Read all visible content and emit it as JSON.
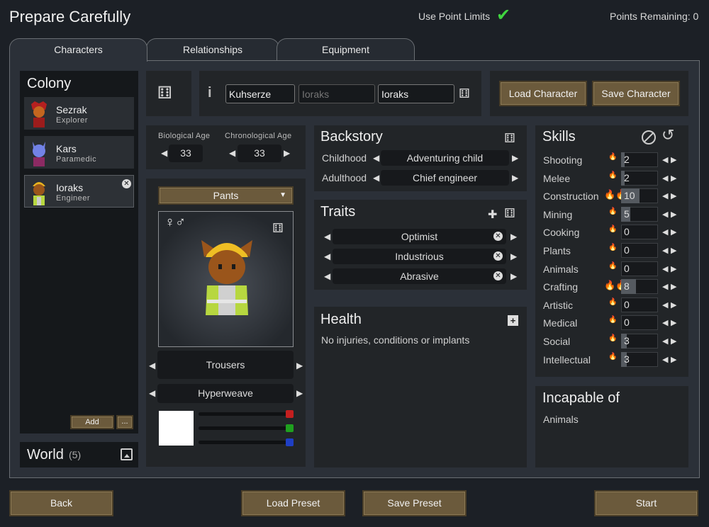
{
  "app_title": "Prepare Carefully",
  "point_limits": {
    "label": "Use Point Limits",
    "enabled": true
  },
  "points_remaining": "Points Remaining: 0",
  "tabs": [
    {
      "label": "Characters",
      "active": true
    },
    {
      "label": "Relationships",
      "active": false
    },
    {
      "label": "Equipment",
      "active": false
    }
  ],
  "colony": {
    "title": "Colony",
    "pawns": [
      {
        "name": "Sezrak",
        "role": "Explorer"
      },
      {
        "name": "Kars",
        "role": "Paramedic"
      },
      {
        "name": "Ioraks",
        "role": "Engineer",
        "selected": true
      }
    ],
    "add_label": "Add",
    "more_label": "..."
  },
  "world": {
    "title": "World",
    "count": "(5)"
  },
  "name_fields": {
    "first": "Kuhserze",
    "nick_placeholder": "Ioraks",
    "last": "Ioraks"
  },
  "load_character": "Load Character",
  "save_character": "Save Character",
  "age": {
    "bio_label": "Biological Age",
    "bio_value": "33",
    "chrono_label": "Chronological Age",
    "chrono_value": "33"
  },
  "apparel": {
    "layer": "Pants",
    "item": "Trousers",
    "material": "Hyperweave",
    "gender_symbols": "♀♂",
    "color": "#ffffff"
  },
  "backstory": {
    "title": "Backstory",
    "childhood_label": "Childhood",
    "childhood_value": "Adventuring child",
    "adulthood_label": "Adulthood",
    "adulthood_value": "Chief engineer"
  },
  "traits": {
    "title": "Traits",
    "items": [
      "Optimist",
      "Industrious",
      "Abrasive"
    ]
  },
  "health": {
    "title": "Health",
    "text": "No injuries, conditions or implants"
  },
  "skills": {
    "title": "Skills",
    "items": [
      {
        "name": "Shooting",
        "value": "2",
        "passion": "none",
        "level": 2
      },
      {
        "name": "Melee",
        "value": "2",
        "passion": "minor",
        "level": 2
      },
      {
        "name": "Construction",
        "value": "10",
        "passion": "major",
        "level": 10
      },
      {
        "name": "Mining",
        "value": "5",
        "passion": "none",
        "level": 5
      },
      {
        "name": "Cooking",
        "value": "0",
        "passion": "none",
        "level": 0
      },
      {
        "name": "Plants",
        "value": "0",
        "passion": "none",
        "level": 0
      },
      {
        "name": "Animals",
        "value": "0",
        "passion": "none",
        "level": 0
      },
      {
        "name": "Crafting",
        "value": "8",
        "passion": "major",
        "level": 8
      },
      {
        "name": "Artistic",
        "value": "0",
        "passion": "none",
        "level": 0
      },
      {
        "name": "Medical",
        "value": "0",
        "passion": "none",
        "level": 0
      },
      {
        "name": "Social",
        "value": "3",
        "passion": "minor",
        "level": 3
      },
      {
        "name": "Intellectual",
        "value": "3",
        "passion": "none",
        "level": 3
      }
    ]
  },
  "incapable": {
    "title": "Incapable of",
    "items": [
      "Animals"
    ]
  },
  "footer": {
    "back": "Back",
    "load_preset": "Load Preset",
    "save_preset": "Save Preset",
    "start": "Start"
  },
  "colors": {
    "button": "#6b5a3c",
    "panel": "#2b3038",
    "passion": "#e78b16",
    "check": "#3fd43f"
  }
}
